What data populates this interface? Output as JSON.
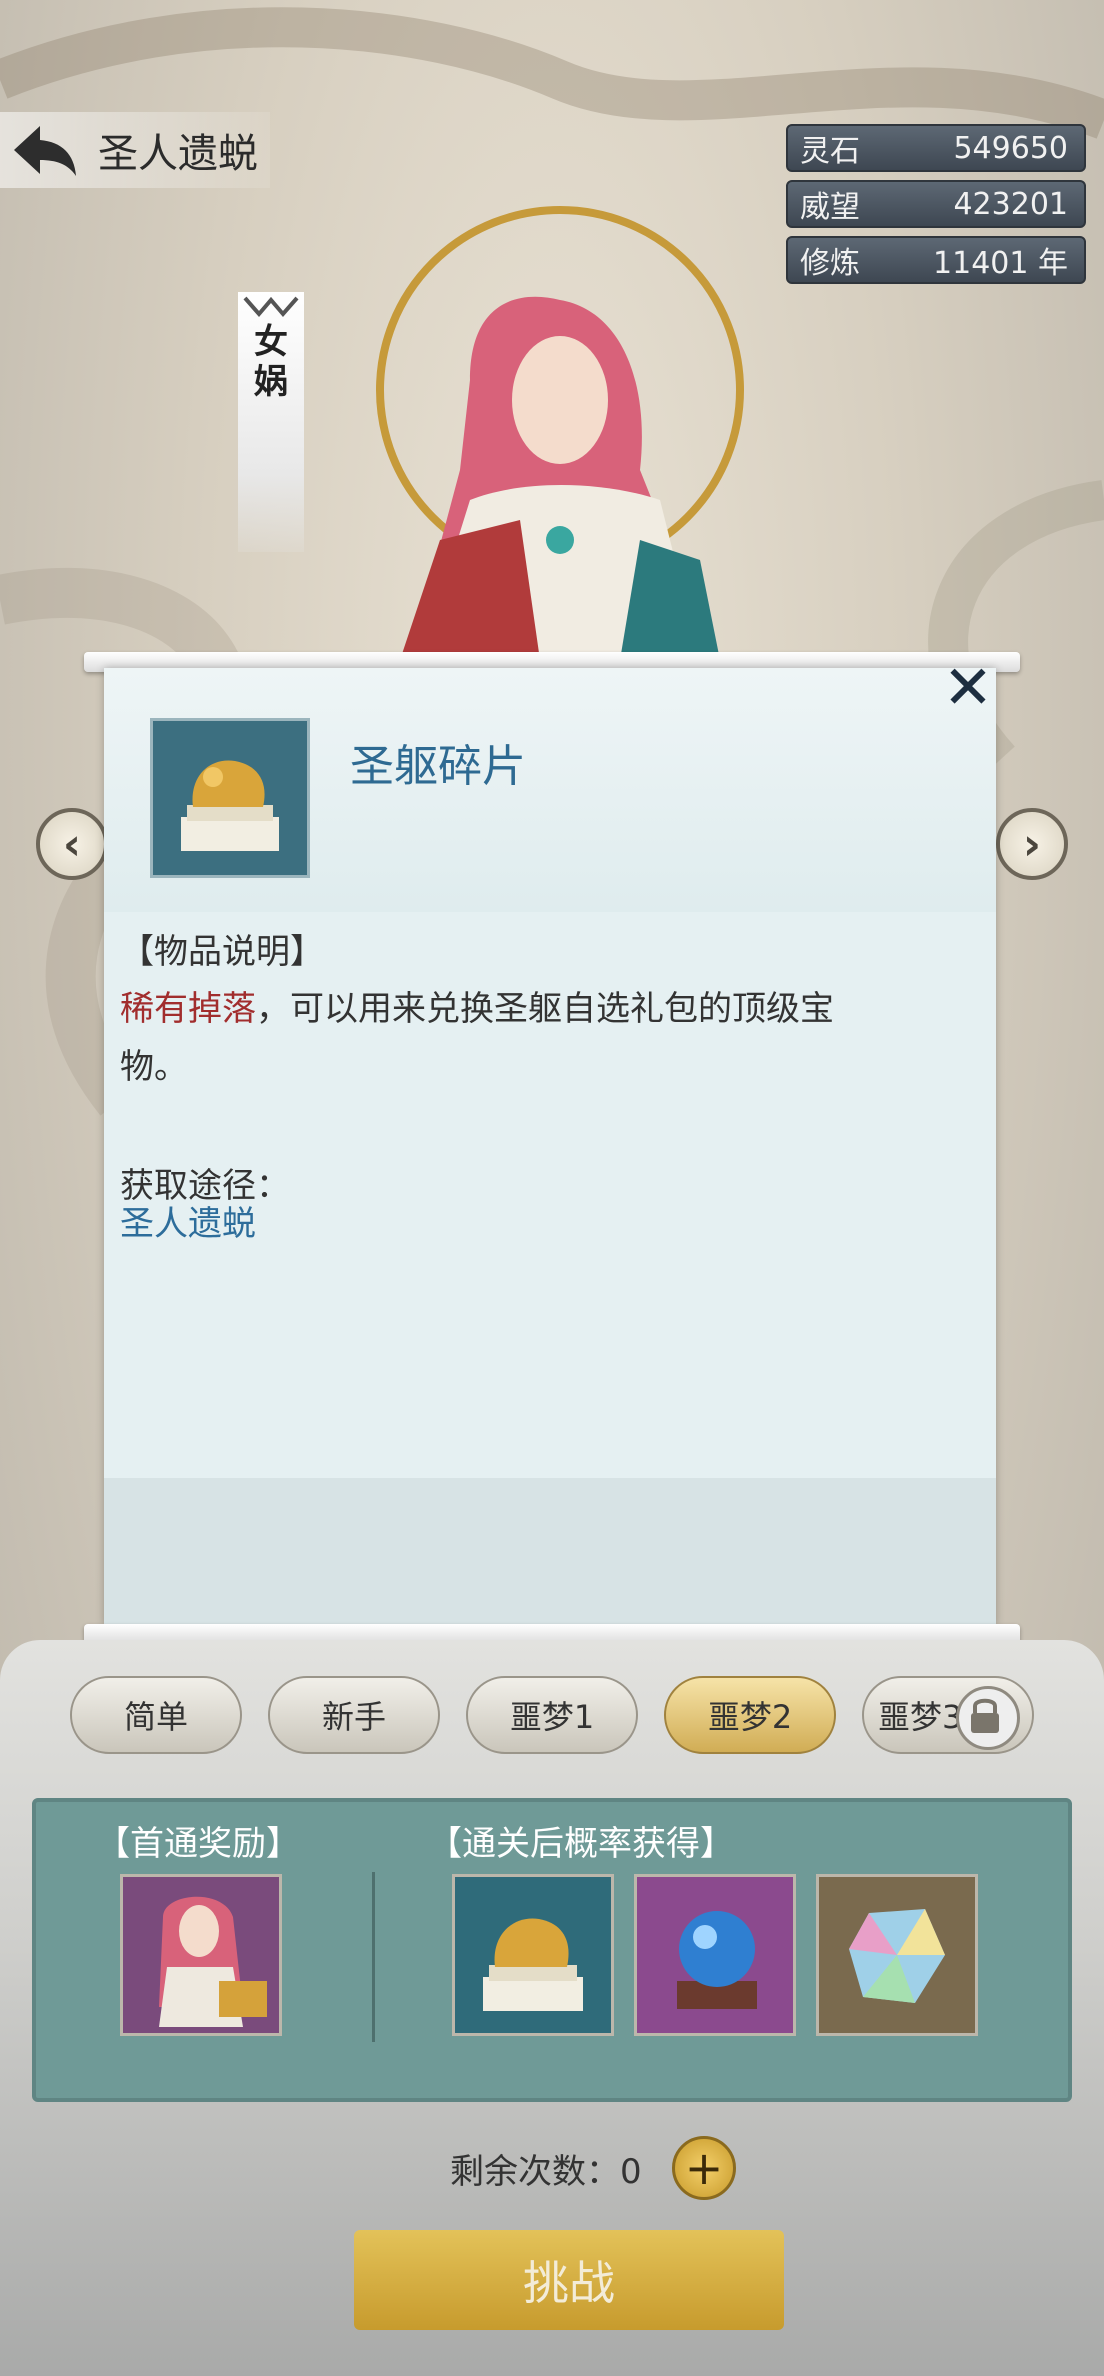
{
  "header": {
    "title": "圣人遗蜕"
  },
  "stats": [
    {
      "label": "灵石",
      "value": "549650"
    },
    {
      "label": "威望",
      "value": "423201"
    },
    {
      "label": "修炼",
      "value": "11401 年"
    }
  ],
  "character": {
    "name_chars": [
      "女",
      "娲"
    ]
  },
  "modal": {
    "item_name": "圣躯碎片",
    "desc_header": "【物品说明】",
    "desc_rare": "稀有掉落",
    "desc_rest_line1": "，可以用来兑换圣躯自选礼包的顶级宝",
    "desc_line2": "物。",
    "acquire_label": "获取途径：",
    "acquire_link": "圣人遗蜕"
  },
  "tabs": [
    "简单",
    "新手",
    "噩梦1",
    "噩梦2",
    "噩梦3"
  ],
  "active_tab": "噩梦2",
  "rewards": {
    "first_clear_label": "【首通奖励】",
    "drop_label": "【通关后概率获得】",
    "first_clear_items": [
      "character-portrait"
    ],
    "drop_items": [
      "golden-seal",
      "blue-orb",
      "rainbow-crystal"
    ]
  },
  "remain": {
    "label": "剩余次数：",
    "count": "0"
  },
  "challenge_label": "挑战",
  "colors": {
    "accent": "#d1ad55",
    "link": "#2d6d9b",
    "rare": "#a12d2d"
  }
}
